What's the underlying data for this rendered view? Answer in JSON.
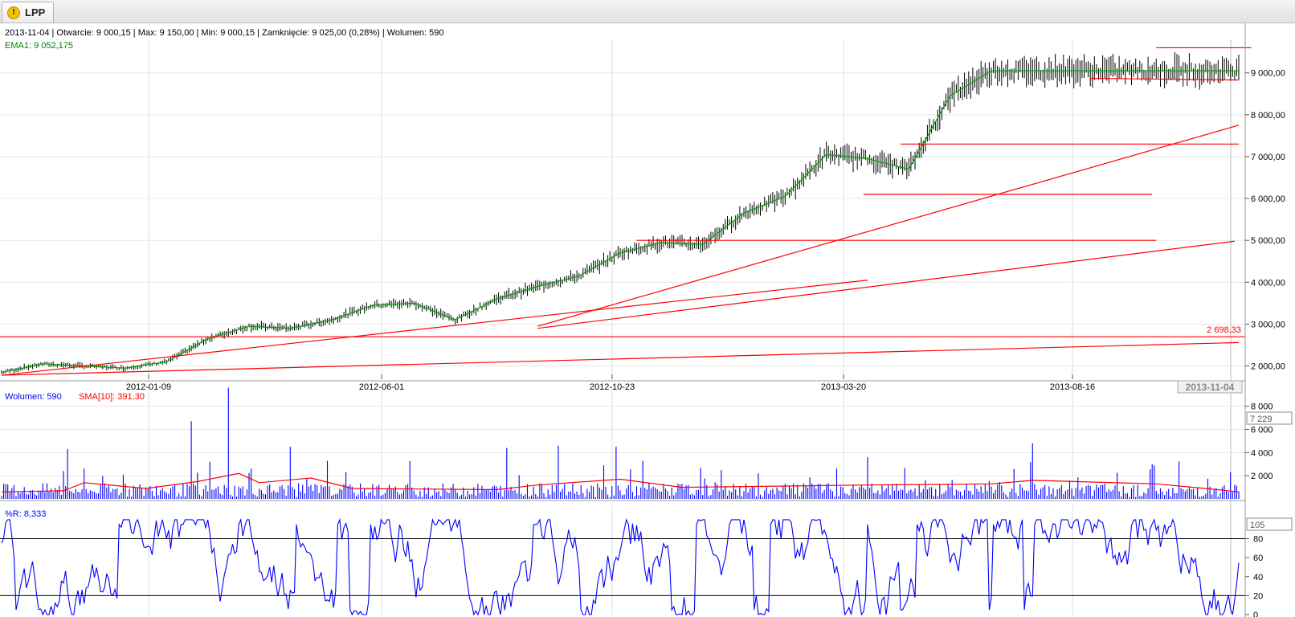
{
  "tab": {
    "label": "LPP",
    "icon": "warning-icon"
  },
  "header": {
    "ohlc": "2013-11-04 | Otwarcie: 9 000,15 | Max: 9 150,00 | Min: 9 000,15 | Zamknięcie: 9 025,00 (0,28%)  | Wolumen: 590",
    "ema": "EMA1: 9 052,175"
  },
  "chart_data": [
    {
      "type": "line",
      "panel": "price",
      "x_ticks": [
        "2012-01-09",
        "2012-06-01",
        "2012-10-23",
        "2013-03-20",
        "2013-08-16"
      ],
      "current_date": "2013-11-04",
      "y_ticks": [
        "9 000,00",
        "8 000,00",
        "7 000,00",
        "6 000,00",
        "5 000,00",
        "4 000,00",
        "3 000,00",
        "2 000,00"
      ],
      "ylim": [
        1800,
        9800
      ],
      "marker_value": "2 698,33",
      "series": [
        {
          "name": "EMA1",
          "x": [
            0,
            20,
            40,
            60,
            80,
            100,
            120,
            140,
            160,
            180,
            200,
            220,
            240,
            260,
            280,
            300,
            320,
            340,
            360,
            380,
            400,
            420,
            440,
            460,
            480
          ],
          "values": [
            1850,
            2050,
            2000,
            1950,
            2100,
            2650,
            2950,
            2900,
            3100,
            3450,
            3500,
            3100,
            3600,
            3900,
            4150,
            4700,
            4950,
            4900,
            5650,
            6050,
            7050,
            6950,
            6700,
            8450,
            9050
          ]
        }
      ],
      "lines": [
        {
          "kind": "horizontal",
          "y": 2698.33
        },
        {
          "kind": "horizontal",
          "y": 5000,
          "x_from": 308,
          "x_to": 560
        },
        {
          "kind": "horizontal",
          "y": 6100,
          "x_from": 418,
          "x_to": 558
        },
        {
          "kind": "horizontal",
          "y": 7300,
          "x_from": 436,
          "x_to": 600
        },
        {
          "kind": "trend",
          "from": [
            0,
            1780
          ],
          "to": [
            600,
            2560
          ]
        },
        {
          "kind": "trend",
          "from": [
            0,
            1780
          ],
          "to": [
            420,
            4050
          ]
        },
        {
          "kind": "trend",
          "from": [
            260,
            2950
          ],
          "to": [
            600,
            7750
          ]
        },
        {
          "kind": "trend",
          "from": [
            260,
            2900
          ],
          "to": [
            598,
            4980
          ]
        },
        {
          "kind": "trend",
          "from": [
            528,
            8870
          ],
          "to": [
            600,
            8830
          ]
        },
        {
          "kind": "horizontal",
          "y": 9600,
          "x_from": 560,
          "x_to": 606
        }
      ]
    },
    {
      "type": "bar",
      "panel": "volume",
      "legend": [
        {
          "name": "Wolumen: 590",
          "color": "#0000ff"
        },
        {
          "name": "SMA[10]: 391,30",
          "color": "#ff0000"
        }
      ],
      "y_ticks": [
        "8 000",
        "6 000",
        "4 000",
        "2 000"
      ],
      "ylim": [
        0,
        9500
      ],
      "current_value": "7 229",
      "peaks": [
        [
          10,
          600
        ],
        [
          32,
          4300
        ],
        [
          92,
          6700
        ],
        [
          110,
          9600
        ],
        [
          140,
          4500
        ],
        [
          245,
          4400
        ],
        [
          270,
          4600
        ],
        [
          298,
          4500
        ],
        [
          420,
          3600
        ],
        [
          500,
          4800
        ],
        [
          596,
          2300
        ]
      ],
      "sma": [
        [
          0,
          600
        ],
        [
          30,
          700
        ],
        [
          40,
          1400
        ],
        [
          70,
          900
        ],
        [
          95,
          1500
        ],
        [
          115,
          2200
        ],
        [
          125,
          1400
        ],
        [
          150,
          1800
        ],
        [
          170,
          900
        ],
        [
          240,
          800
        ],
        [
          260,
          1200
        ],
        [
          300,
          1700
        ],
        [
          330,
          1000
        ],
        [
          420,
          1200
        ],
        [
          480,
          1300
        ],
        [
          500,
          1600
        ],
        [
          560,
          1300
        ],
        [
          590,
          800
        ],
        [
          600,
          600
        ]
      ]
    },
    {
      "type": "line",
      "panel": "williams-r",
      "title": "%R: 8,333",
      "y_ticks": [
        "80",
        "60",
        "40",
        "20",
        "0"
      ],
      "ylim": [
        0,
        105
      ],
      "current_value": "105",
      "levels": [
        80,
        20
      ]
    }
  ]
}
